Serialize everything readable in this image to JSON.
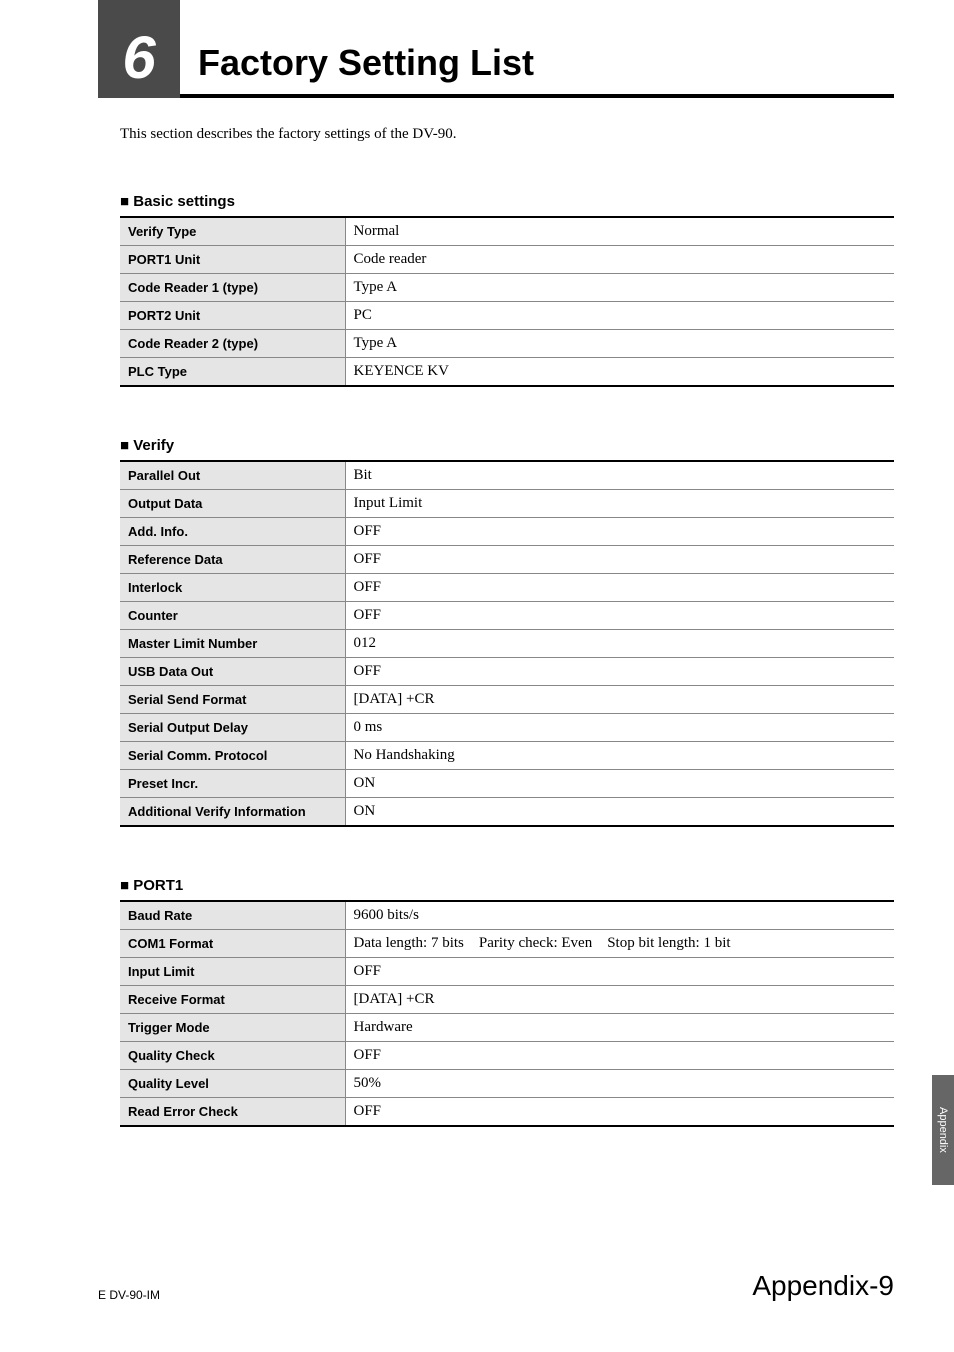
{
  "chapter": {
    "number": "6",
    "title": "Factory Setting List"
  },
  "intro": "This section describes the factory settings of the DV-90.",
  "sections": [
    {
      "heading": "Basic settings",
      "rows": [
        {
          "label": "Verify Type",
          "value": "Normal"
        },
        {
          "label": "PORT1 Unit",
          "value": "Code reader"
        },
        {
          "label": "Code Reader 1 (type)",
          "value": "Type A"
        },
        {
          "label": "PORT2 Unit",
          "value": "PC"
        },
        {
          "label": "Code Reader 2 (type)",
          "value": "Type A"
        },
        {
          "label": "PLC Type",
          "value": "KEYENCE KV"
        }
      ]
    },
    {
      "heading": "Verify",
      "rows": [
        {
          "label": "Parallel Out",
          "value": "Bit"
        },
        {
          "label": "Output Data",
          "value": "Input Limit"
        },
        {
          "label": "Add. Info.",
          "value": "OFF"
        },
        {
          "label": "Reference Data",
          "value": "OFF"
        },
        {
          "label": "Interlock",
          "value": "OFF"
        },
        {
          "label": "Counter",
          "value": "OFF"
        },
        {
          "label": "Master Limit Number",
          "value": "012"
        },
        {
          "label": "USB Data Out",
          "value": "OFF"
        },
        {
          "label": "Serial Send Format",
          "value": "[DATA] +CR"
        },
        {
          "label": "Serial Output Delay",
          "value": "0 ms"
        },
        {
          "label": "Serial Comm. Protocol",
          "value": "No Handshaking"
        },
        {
          "label": "Preset Incr.",
          "value": "ON"
        },
        {
          "label": "Additional Verify Information",
          "value": "ON"
        }
      ]
    },
    {
      "heading": "PORT1",
      "rows": [
        {
          "label": "Baud Rate",
          "value": "9600 bits/s"
        },
        {
          "label": "COM1 Format",
          "value": "Data length: 7 bits    Parity check: Even    Stop bit length: 1 bit"
        },
        {
          "label": "Input Limit",
          "value": "OFF"
        },
        {
          "label": "Receive Format",
          "value": "[DATA] +CR"
        },
        {
          "label": "Trigger Mode",
          "value": "Hardware"
        },
        {
          "label": "Quality Check",
          "value": "OFF"
        },
        {
          "label": "Quality Level",
          "value": "50%"
        },
        {
          "label": "Read Error Check",
          "value": "OFF"
        }
      ]
    }
  ],
  "sideTab": "Appendix",
  "footer": {
    "left": "E DV-90-IM",
    "right": "Appendix-9"
  }
}
